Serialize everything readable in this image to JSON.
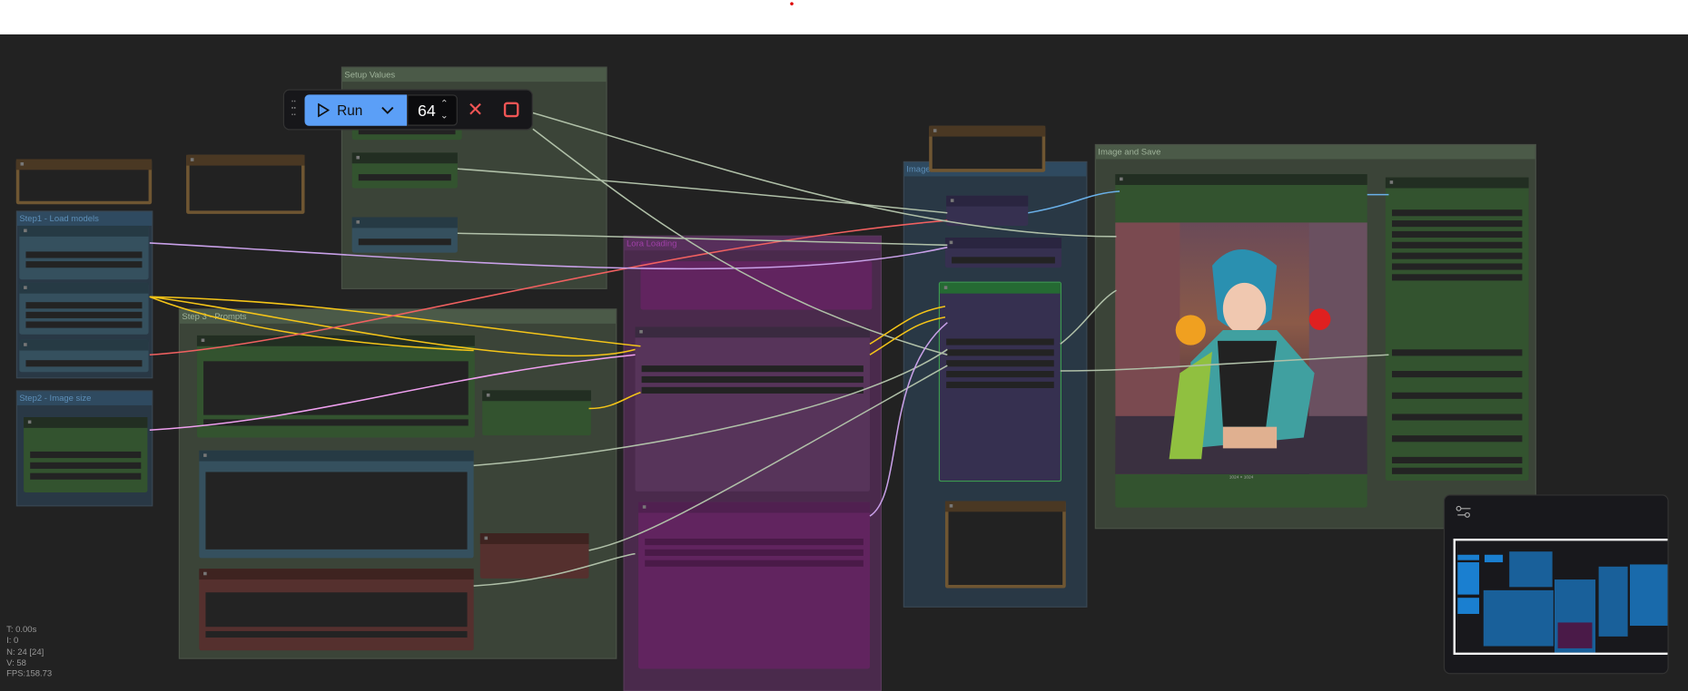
{
  "toolbar": {
    "run_label": "Run",
    "batch_count": "64"
  },
  "groups": {
    "setup_values": "Setup Values",
    "load_models": "Step1 - Load models",
    "image_size": "Step2 - Image size",
    "prompts": "Step 3 - Prompts",
    "lora": "Lora Loading",
    "image": "Image",
    "image_save": "Image and Save"
  },
  "preview": {
    "caption": "1024 × 1024"
  },
  "stats": {
    "t": "T: 0.00s",
    "i": "I: 0",
    "n": "N: 24 [24]",
    "v": "V: 58",
    "fps": "FPS:158.73"
  },
  "colors": {
    "run_button": "#5b9ff7",
    "stop": "#f05555",
    "canvas": "#222222"
  },
  "icons": {
    "drag": "drag-handle-icon",
    "play": "play-icon",
    "chevron": "chevron-down-icon",
    "spinner": "spinner-arrows-icon",
    "cancel": "x-icon",
    "stop": "square-icon",
    "minimap_settings": "sliders-icon"
  }
}
